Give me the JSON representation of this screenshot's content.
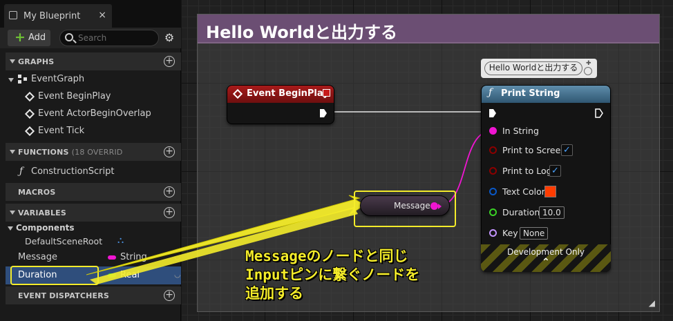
{
  "tab": {
    "title": "My Blueprint",
    "close": "×"
  },
  "toolbar": {
    "add_label": "Add",
    "search_placeholder": "Search"
  },
  "sections": {
    "graphs": "GRAPHS",
    "functions": "FUNCTIONS",
    "functions_sub": "(18 OVERRID",
    "macros": "MACROS",
    "variables": "VARIABLES",
    "event_dispatchers": "EVENT DISPATCHERS"
  },
  "graphs": {
    "event_graph": "EventGraph",
    "events": [
      "Event BeginPlay",
      "Event ActorBeginOverlap",
      "Event Tick"
    ]
  },
  "functions": {
    "construction_script": "ConstructionScript"
  },
  "variables": {
    "components_label": "Components",
    "default_scene_root": "DefaultSceneRoot",
    "items": [
      {
        "name": "Message",
        "type": "String",
        "color": "#f015d2"
      },
      {
        "name": "Duration",
        "type": "Real",
        "color": "#3ad226"
      }
    ]
  },
  "comment": {
    "title": "Hello Worldと出力する",
    "color": "#6b4e73"
  },
  "nodes": {
    "begin_play": {
      "title": "Event BeginPlay",
      "color": "#8e1515"
    },
    "print_string": {
      "title": "Print String",
      "comment_bubble": "Hello Worldと出力する",
      "pins": {
        "in_string": "In String",
        "print_to_screen": "Print to Screen",
        "print_to_log": "Print to Log",
        "text_color": "Text Color",
        "duration": "Duration",
        "duration_value": "10.0",
        "key": "Key",
        "key_value": "None"
      },
      "dev_only": "Development Only"
    },
    "message": {
      "label": "Message"
    }
  },
  "colors": {
    "string_pin": "#f015d2",
    "bool_pin": "#8c0000",
    "struct_pin": "#0a58c8",
    "float_pin": "#3ad226",
    "name_pin": "#c394ff",
    "text_color_swatch": "#ff3c00",
    "annotation": "#f4ec2a",
    "selection": "#2f4e7c"
  },
  "annotation": {
    "line1": "Messageのノードと同じ",
    "line2": "Inputピンに繋ぐノードを",
    "line3": "追加する"
  }
}
